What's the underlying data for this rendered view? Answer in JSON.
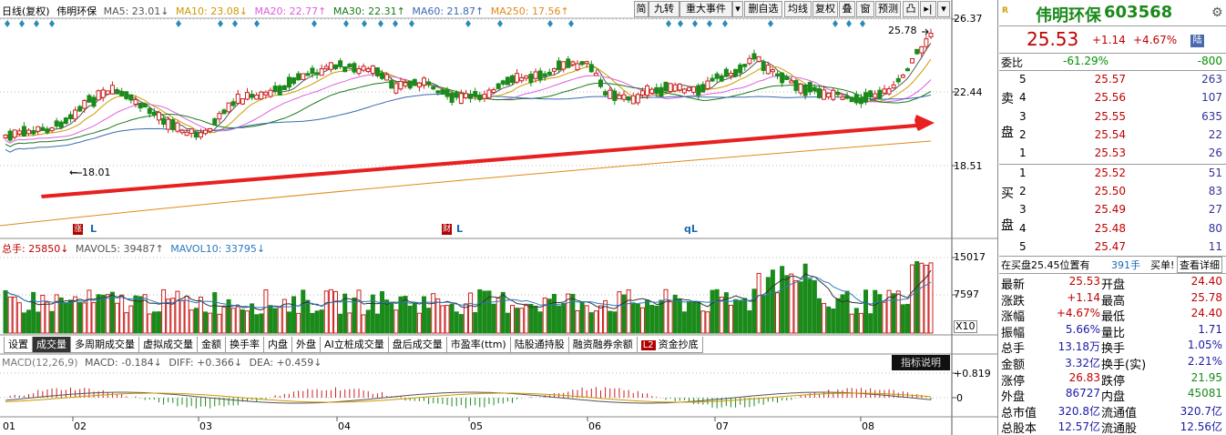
{
  "price_legend": {
    "period": "日线(复权)",
    "name": "伟明环保",
    "ma5": "MA5: 23.01↓",
    "ma10": "MA10: 23.08↓",
    "ma20": "MA20: 22.77↑",
    "ma30": "MA30: 22.31↑",
    "ma60": "MA60: 21.87↑",
    "ma250": "MA250: 17.56↑"
  },
  "toolbar": [
    "简",
    "九转",
    "重大事件",
    "▾",
    "删自选",
    "均线",
    "复权",
    "叠",
    "窗",
    "预测",
    "凸",
    "▸|",
    "▾"
  ],
  "price_scale": [
    "26.37",
    "22.44",
    "18.51"
  ],
  "price_annotations": {
    "high": "25.78",
    "low": "18.01",
    "low_arrow": "←"
  },
  "price_markers": [
    "L",
    "L",
    "qL"
  ],
  "event_icons": [
    {
      "text": "涨",
      "color": "#b00000"
    },
    {
      "text": "财",
      "color": "#b00000"
    }
  ],
  "colors": {
    "up": "#cc2020",
    "down": "#1a8a1a",
    "ma5": "#555555",
    "ma10": "#cc9900",
    "ma20": "#e05ce0",
    "ma30": "#1a7a1a",
    "ma60": "#3a6ab0",
    "ma250": "#e08a1a",
    "trend_arrow": "#e82020",
    "accent": "#c00000",
    "diamond": "#2a8ab8",
    "tab_active": "#333333"
  },
  "volume_legend": {
    "total": "总手: 25850↓",
    "mavol5": "MAVOL5: 39487↑",
    "mavol10": "MAVOL10: 33795↓"
  },
  "volume_scale": [
    "15017",
    "7597",
    "X10"
  ],
  "tabs": [
    "设置",
    "成交量",
    "多周期成交量",
    "虚拟成交量",
    "金额",
    "换手率",
    "内盘",
    "外盘",
    "AI立桩成交量",
    "盘后成交量",
    "市盈率(ttm)",
    "陆股通持股",
    "融资融券余额",
    "资金抄底"
  ],
  "tab_badge": "L2",
  "macd_legend": {
    "name": "MACD(12,26,9)",
    "macd": "MACD: -0.184↓",
    "diff": "DIFF: +0.366↓",
    "dea": "DEA: +0.459↓"
  },
  "macd_button": "指标说明",
  "macd_scale": [
    "+0.819",
    "0"
  ],
  "months": [
    "01",
    "02",
    "03",
    "04",
    "05",
    "06",
    "07",
    "08"
  ],
  "quote": {
    "logo": "R",
    "name": "伟明环保",
    "code": "603568",
    "price": "25.53",
    "change": "+1.14",
    "pct": "+4.67%",
    "market": "陆",
    "weibi_label": "委比",
    "weibi_pct": "-61.29%",
    "weibi_val": "-800",
    "sell_label": [
      "卖",
      "盘"
    ],
    "buy_label": [
      "买",
      "盘"
    ],
    "sell": [
      {
        "lvl": "5",
        "price": "25.57",
        "vol": "263"
      },
      {
        "lvl": "4",
        "price": "25.56",
        "vol": "107"
      },
      {
        "lvl": "3",
        "price": "25.55",
        "vol": "635"
      },
      {
        "lvl": "2",
        "price": "25.54",
        "vol": "22"
      },
      {
        "lvl": "1",
        "price": "25.53",
        "vol": "26"
      }
    ],
    "buy": [
      {
        "lvl": "1",
        "price": "25.52",
        "vol": "51"
      },
      {
        "lvl": "2",
        "price": "25.50",
        "vol": "83"
      },
      {
        "lvl": "3",
        "price": "25.49",
        "vol": "27"
      },
      {
        "lvl": "4",
        "price": "25.48",
        "vol": "80"
      },
      {
        "lvl": "5",
        "price": "25.47",
        "vol": "11"
      }
    ],
    "position_text": "在买盘25.45位置有",
    "position_vol": "391手",
    "position_btn": "买单!",
    "detail_btn": "查看详细",
    "stats": [
      [
        "最新",
        "25.53",
        "开盘",
        "24.40"
      ],
      [
        "涨跌",
        "+1.14",
        "最高",
        "25.78"
      ],
      [
        "涨幅",
        "+4.67%",
        "最低",
        "24.40"
      ],
      [
        "振幅",
        "5.66%",
        "量比",
        "1.71"
      ],
      [
        "总手",
        "13.18万",
        "换手",
        "1.05%"
      ],
      [
        "金额",
        "3.32亿",
        "换手(实)",
        "2.21%"
      ],
      [
        "涨停",
        "26.83",
        "跌停",
        "21.95"
      ],
      [
        "外盘",
        "86727",
        "内盘",
        "45081"
      ],
      [
        "总市值",
        "320.8亿",
        "流通值",
        "320.7亿"
      ],
      [
        "总股本",
        "12.57亿",
        "流通股",
        "12.56亿"
      ]
    ]
  }
}
